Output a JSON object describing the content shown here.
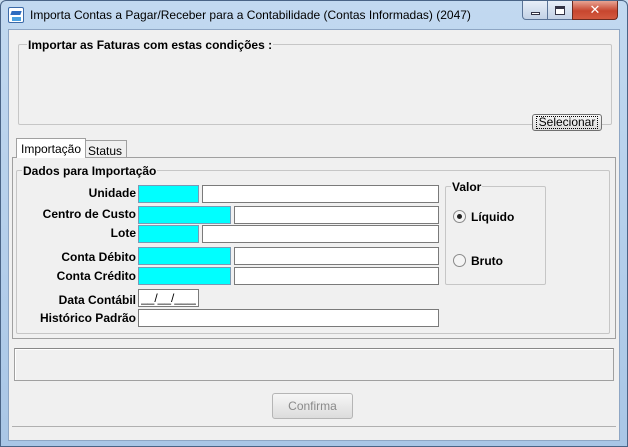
{
  "window": {
    "title": "Importa Contas a Pagar/Receber para a Contabilidade (Contas Informadas) (2047)",
    "minimize": "minimize",
    "maximize": "maximize",
    "close": "✕"
  },
  "conditions": {
    "legend": "Importar as Faturas com estas condições :",
    "select_button": "Selecionar"
  },
  "tabs": [
    {
      "label": "Importação",
      "active": true
    },
    {
      "label": "Status",
      "active": false
    }
  ],
  "import_data": {
    "legend": "Dados para Importação",
    "fields": {
      "unidade": {
        "label": "Unidade",
        "code": "",
        "description": ""
      },
      "centro_custo": {
        "label": "Centro de Custo",
        "code": "",
        "description": ""
      },
      "lote": {
        "label": "Lote",
        "code": "",
        "description": ""
      },
      "conta_debito": {
        "label": "Conta Débito",
        "code": "",
        "description": ""
      },
      "conta_credito": {
        "label": "Conta Crédito",
        "code": "",
        "description": ""
      },
      "data_contabil": {
        "label": "Data Contábil",
        "value": "__/__/____"
      },
      "historico_padrao": {
        "label": "Histórico Padrão",
        "value": ""
      }
    }
  },
  "valor": {
    "legend": "Valor",
    "options": [
      {
        "label": "Líquido",
        "checked": true
      },
      {
        "label": "Bruto",
        "checked": false
      }
    ]
  },
  "actions": {
    "confirm": "Confirma"
  },
  "colors": {
    "code_field_bg": "#00ffff",
    "close_button": "#c7462f"
  }
}
